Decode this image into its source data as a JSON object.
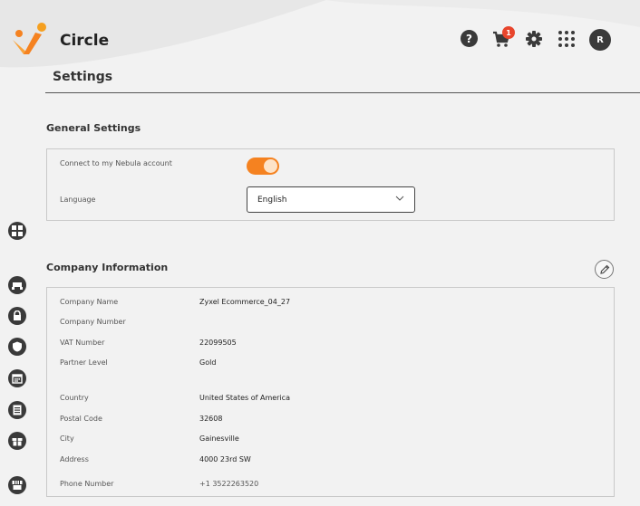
{
  "header": {
    "app_title": "Circle",
    "help_glyph": "?",
    "cart_count": "1",
    "avatar_initial": "R",
    "icons": [
      "logo-icon",
      "help-icon",
      "cart-icon",
      "gear-icon",
      "apps-grid-icon"
    ]
  },
  "page": {
    "title": "Settings"
  },
  "sidebar": {
    "icons": [
      "dashboard-icon",
      "devices-icon",
      "lock-icon",
      "shield-icon",
      "calendar-icon",
      "document-icon",
      "gift-icon",
      "store-icon"
    ]
  },
  "general": {
    "title": "General Settings",
    "nebula_label": "Connect to my Nebula account",
    "nebula_on": true,
    "language_label": "Language",
    "language_value": "English"
  },
  "company": {
    "title": "Company Information",
    "rows": [
      {
        "label": "Company Name",
        "value": "Zyxel Ecommerce_04_27"
      },
      {
        "label": "Company Number",
        "value": ""
      },
      {
        "label": "VAT Number",
        "value": "22099505"
      },
      {
        "label": "Partner Level",
        "value": "Gold"
      },
      {
        "label": "Country",
        "value": "United States of America"
      },
      {
        "label": "Postal Code",
        "value": "32608"
      },
      {
        "label": "City",
        "value": "Gainesville"
      },
      {
        "label": "Address",
        "value": "4000 23rd SW"
      },
      {
        "label": "Phone Number",
        "value": "+1 3522263520"
      }
    ]
  },
  "colors": {
    "accent": "#f58220",
    "badge": "#e8452c",
    "dark_icon": "#3a3a3a",
    "background": "#f2f2f2"
  }
}
